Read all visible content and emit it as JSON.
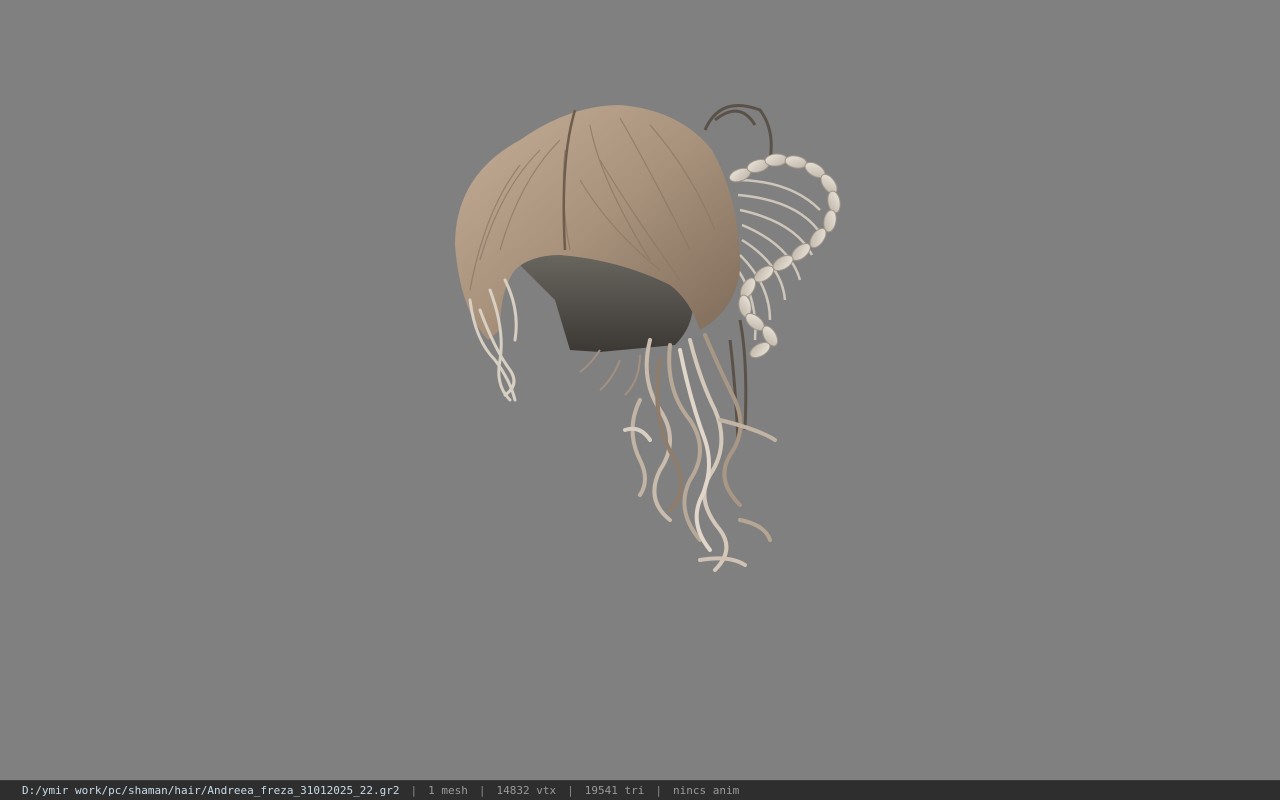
{
  "viewer": {
    "background_color": "#808080",
    "model_icon": "hair-mesh-model",
    "hair_color": "#b09a85"
  },
  "statusbar": {
    "file_path": "D:/ymir work/pc/shaman/hair/Andreea_freza_31012025_22.gr2",
    "separator": "|",
    "mesh_count": "1 mesh",
    "vertex_count": "14832 vtx",
    "triangle_count": "19541 tri",
    "animation": "nincs anim"
  }
}
